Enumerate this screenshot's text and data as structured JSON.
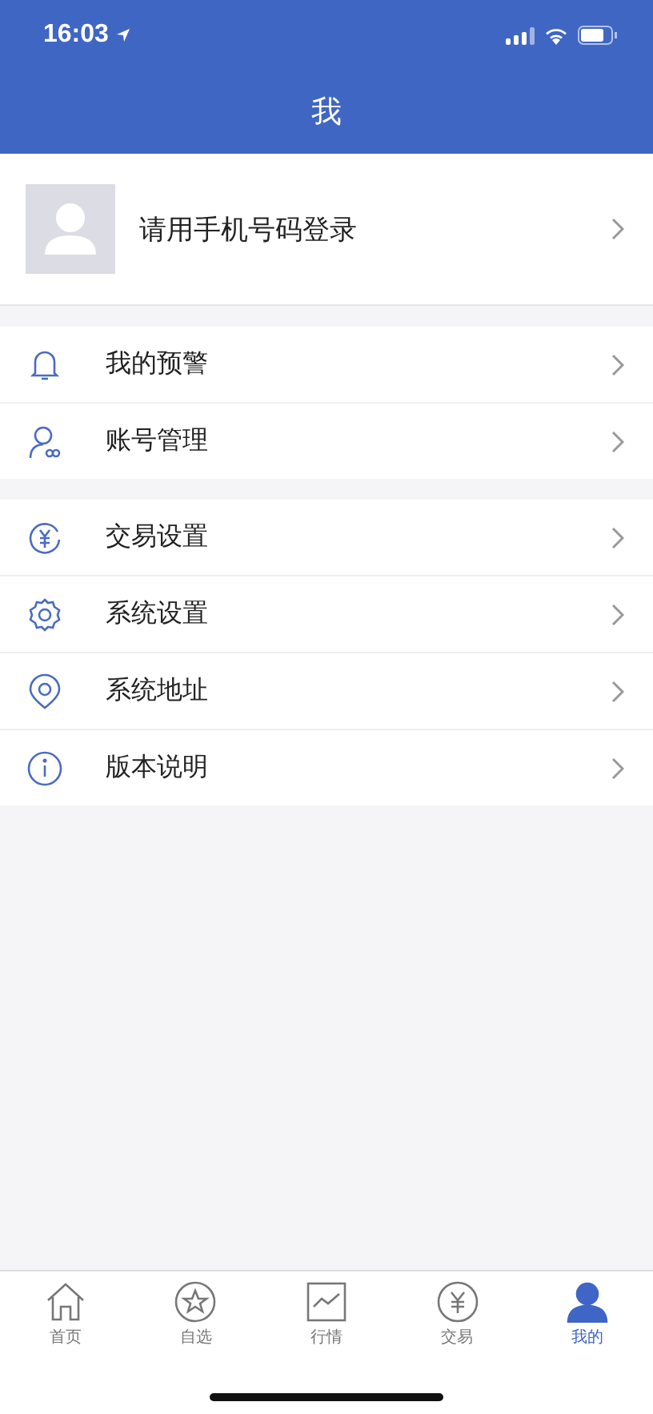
{
  "status_bar": {
    "time": "16:03"
  },
  "header": {
    "title": "我"
  },
  "profile": {
    "label": "请用手机号码登录"
  },
  "groups": [
    {
      "items": [
        {
          "label": "我的预警"
        },
        {
          "label": "账号管理"
        }
      ]
    },
    {
      "items": [
        {
          "label": "交易设置"
        },
        {
          "label": "系统设置"
        },
        {
          "label": "系统地址"
        },
        {
          "label": "版本说明"
        }
      ]
    }
  ],
  "tabs": [
    {
      "label": "首页",
      "selected": false
    },
    {
      "label": "自选",
      "selected": false
    },
    {
      "label": "行情",
      "selected": false
    },
    {
      "label": "交易",
      "selected": false
    },
    {
      "label": "我的",
      "selected": true
    }
  ]
}
